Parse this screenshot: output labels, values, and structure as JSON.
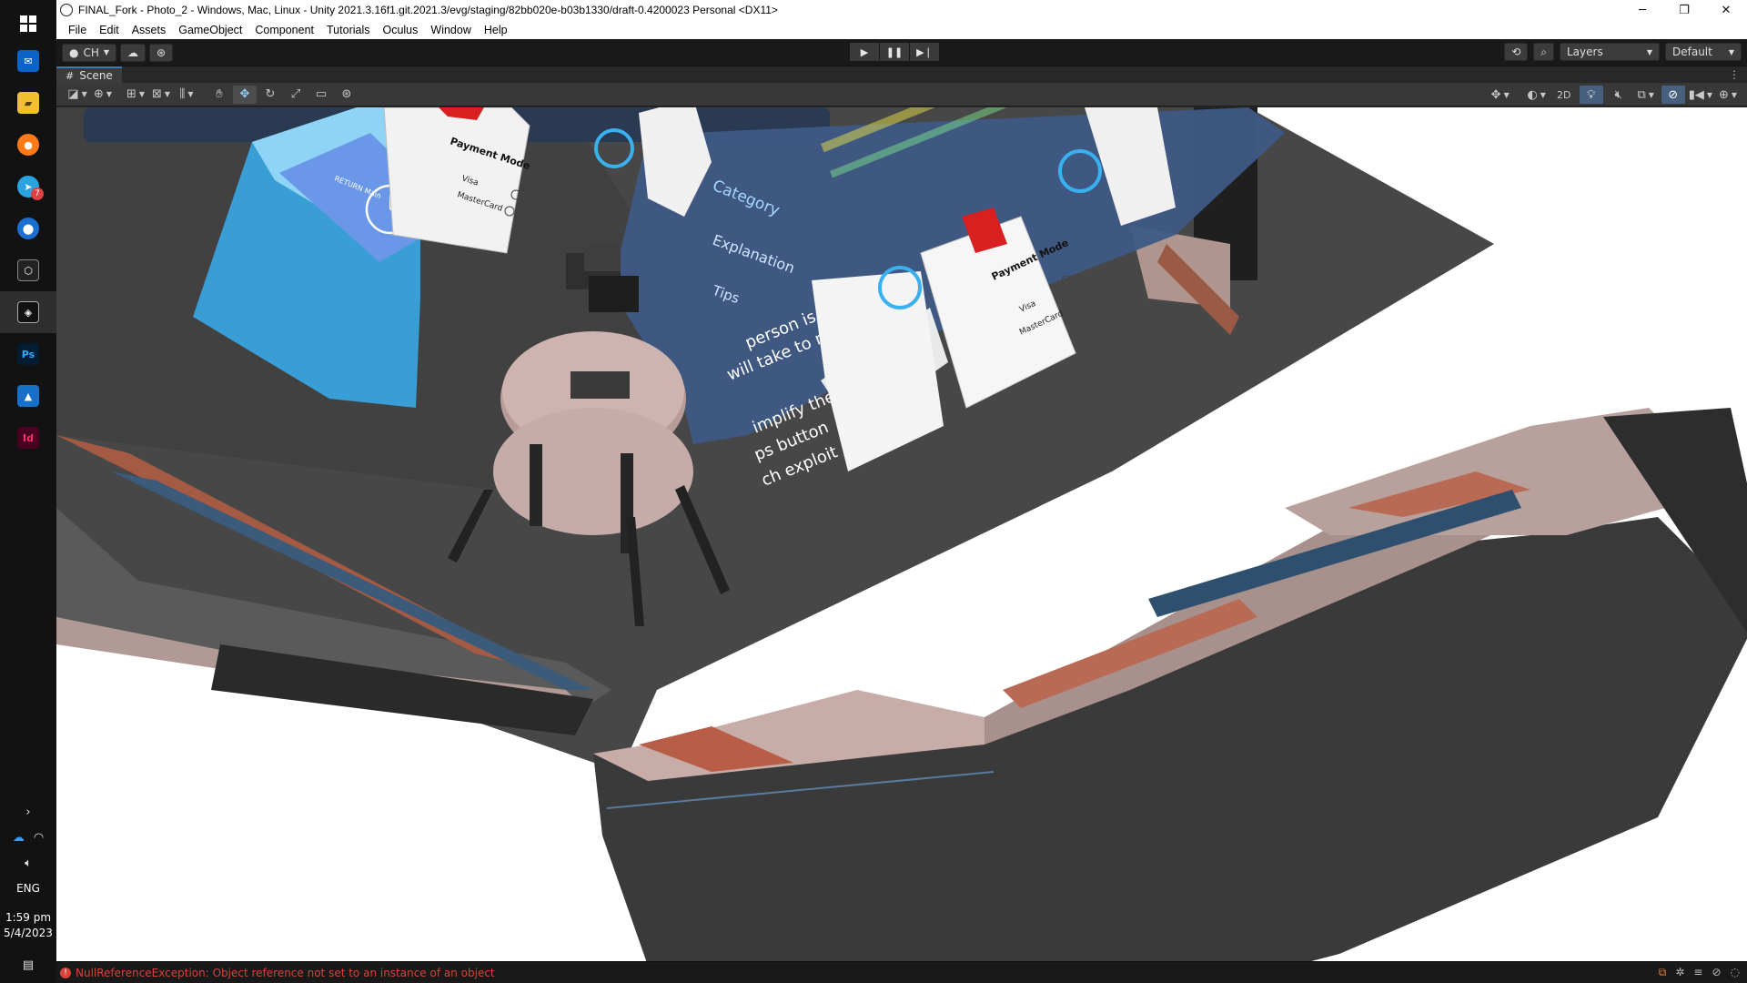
{
  "window": {
    "title": "FINAL_Fork - Photo_2 - Windows, Mac, Linux - Unity 2021.3.16f1.git.2021.3/evg/staging/82bb020e-b03b1330/draft-0.4200023 Personal <DX11>"
  },
  "menu": [
    "File",
    "Edit",
    "Assets",
    "GameObject",
    "Component",
    "Tutorials",
    "Oculus",
    "Window",
    "Help"
  ],
  "toolbar": {
    "account_label": "CH",
    "layers_label": "Layers",
    "layout_label": "Default"
  },
  "scene_tab": {
    "label": "Scene"
  },
  "scene_view": {
    "mode_2d_label": "2D"
  },
  "panels": {
    "left_card": {
      "title": "Payment Mode",
      "options": [
        "Visa",
        "MasterCard"
      ]
    },
    "center_card": {
      "title": "Payment Mode",
      "options": [
        "Visa",
        "MasterCard"
      ]
    },
    "info_panel": {
      "heading_1": "Category",
      "heading_2": "Explanation",
      "heading_3": "Tips",
      "line_1": "person is",
      "line_2": "will take to reach a",
      "line_3": "implify the",
      "line_4": "ps button",
      "line_5": "ch exploit"
    },
    "clock_card": {
      "label": "RETURN Main"
    }
  },
  "taskbar": {
    "language": "ENG",
    "time": "1:59 pm",
    "date": "5/4/2023",
    "telegram_badge": "7"
  },
  "status": {
    "message": "NullReferenceException: Object reference not set to an instance of an object"
  }
}
